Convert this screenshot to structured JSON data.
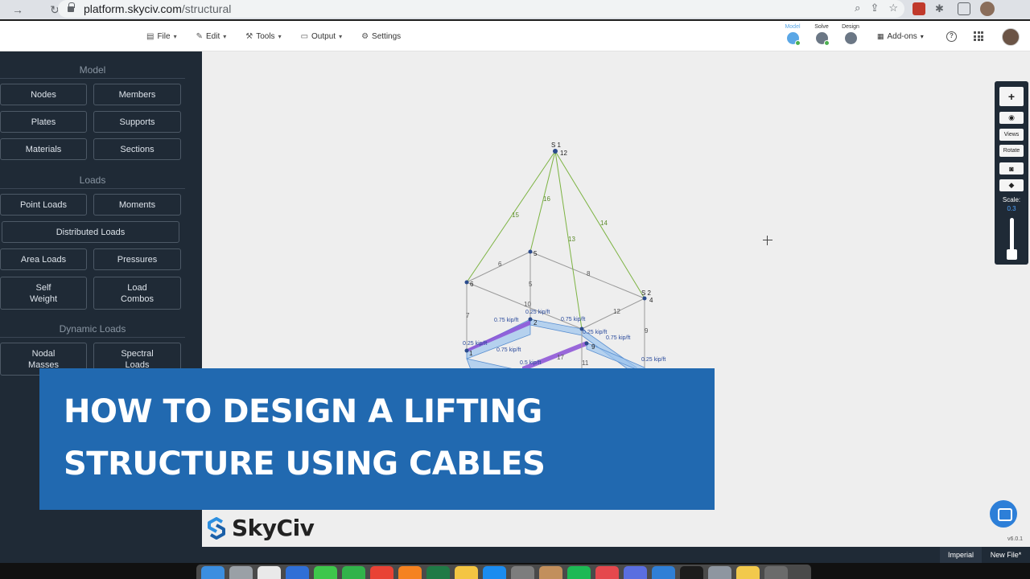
{
  "browser": {
    "url_domain": "platform.skyciv.com",
    "url_path": "/structural"
  },
  "toolbar": {
    "menus": [
      {
        "label": "File",
        "icon": "file-icon"
      },
      {
        "label": "Edit",
        "icon": "pencil-icon"
      },
      {
        "label": "Tools",
        "icon": "wrench-icon"
      },
      {
        "label": "Output",
        "icon": "monitor-icon"
      },
      {
        "label": "Settings",
        "icon": "gear-icon"
      }
    ],
    "steps": [
      {
        "label": "Model",
        "color": "#5aa7e6",
        "active": true
      },
      {
        "label": "Solve",
        "color": "#6b7785",
        "active": false
      },
      {
        "label": "Design",
        "color": "#6b7785",
        "active": false
      }
    ],
    "addons_label": "Add-ons"
  },
  "sidebar": {
    "model_title": "Model",
    "loads_title": "Loads",
    "dynamic_title": "Dynamic Loads",
    "buttons": {
      "nodes": "Nodes",
      "members": "Members",
      "plates": "Plates",
      "supports": "Supports",
      "materials": "Materials",
      "sections": "Sections",
      "point_loads": "Point Loads",
      "moments": "Moments",
      "distributed_loads": "Distributed Loads",
      "area_loads": "Area Loads",
      "pressures": "Pressures",
      "self_weight": "Self\nWeight",
      "load_combos": "Load\nCombos",
      "nodal_masses": "Nodal\nMasses",
      "spectral_loads": "Spectral\nLoads"
    }
  },
  "model": {
    "support_labels": [
      "S 1",
      "S 2"
    ],
    "node_labels": [
      "12",
      "5",
      "6",
      "2",
      "1",
      "9",
      "4"
    ],
    "member_labels": [
      "15",
      "16",
      "13",
      "14",
      "6",
      "8",
      "5",
      "10",
      "7",
      "12",
      "9",
      "11",
      "17"
    ],
    "load_labels": [
      "0.75 kip/ft",
      "0.25 kip/ft",
      "0.75 kip/ft",
      "0.25 kip/ft",
      "0.75 kip/ft",
      "0.75 kip/ft",
      "0.5 kip/ft",
      "0.25 kip/ft",
      "0.25 kip/ft"
    ]
  },
  "right_tools": {
    "views_label": "Views",
    "rotate_label": "Rotate",
    "scale_label": "Scale:",
    "scale_value": "0.3"
  },
  "banner": {
    "line1": "HOW TO DESIGN A LIFTING",
    "line2": "STRUCTURE USING CABLES"
  },
  "logo_text": "SkyCiv",
  "version": "v6.0.1",
  "status": {
    "units": "Imperial",
    "file": "New File*"
  },
  "colors": {
    "sidebar_bg": "#1f2a36",
    "banner_bg": "#2169b0",
    "cable_green": "#7cb342",
    "load_blue": "#7fb3e8",
    "load_purple": "#7e3fc9"
  }
}
